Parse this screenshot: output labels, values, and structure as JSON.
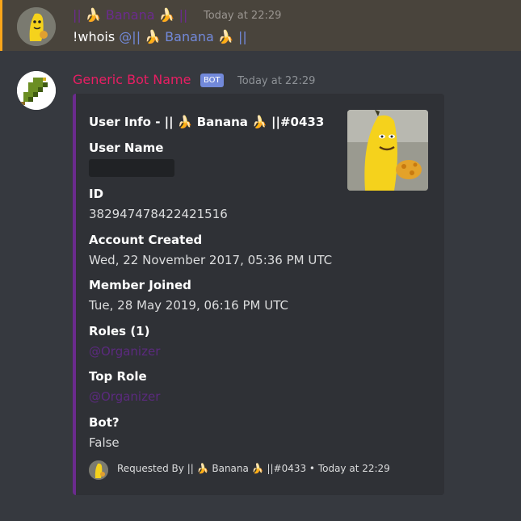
{
  "message1": {
    "username": "|| 🍌 Banana 🍌 ||",
    "timestamp": "Today at 22:29",
    "content_prefix": "!whois ",
    "mention": "@|| 🍌 Banana 🍌 ||"
  },
  "message2": {
    "username": "Generic Bot Name",
    "badge": "BOT",
    "timestamp": "Today at 22:29",
    "embed": {
      "title": "User Info - || 🍌 Banana 🍌 ||#0433",
      "fields": [
        {
          "name": "User Name",
          "value": ""
        },
        {
          "name": "ID",
          "value": "382947478422421516"
        },
        {
          "name": "Account Created",
          "value": "Wed, 22 November 2017, 05:36 PM UTC"
        },
        {
          "name": "Member Joined",
          "value": "Tue, 28 May 2019, 06:16 PM UTC"
        },
        {
          "name": "Roles (1)",
          "value": "@Organizer"
        },
        {
          "name": "Top Role",
          "value": "@Organizer"
        },
        {
          "name": "Bot?",
          "value": "False"
        }
      ],
      "footer": "Requested By || 🍌 Banana 🍌 ||#0433 • Today at 22:29"
    }
  },
  "colors": {
    "background": "#36393f",
    "highlight": "#49443c",
    "accent": "#faa61a",
    "embed_bar": "#6b2b8e",
    "bot_name": "#e91e63",
    "mention": "#7289da"
  }
}
